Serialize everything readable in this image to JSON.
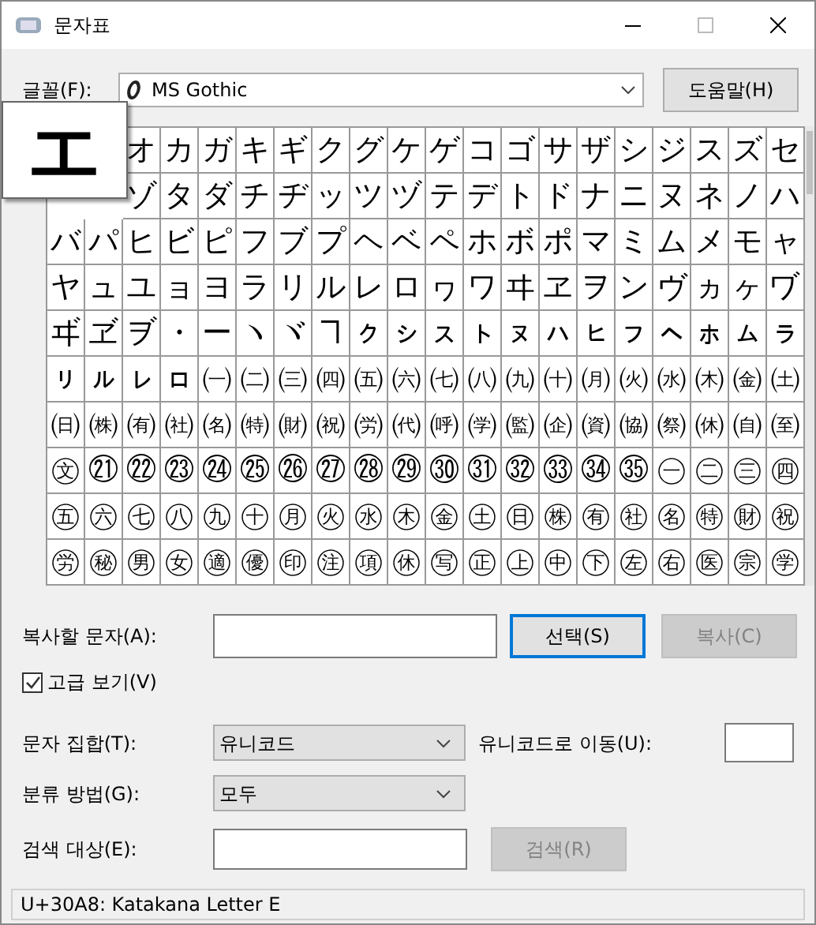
{
  "window": {
    "title": "문자표"
  },
  "font": {
    "label": "글꼴(F):",
    "value": "MS Gothic",
    "help_button": "도움말(H)"
  },
  "magnifier": {
    "char": "エ"
  },
  "grid": [
    [
      "オ",
      "カ",
      "ガ",
      "キ",
      "ギ",
      "ク",
      "グ",
      "ケ",
      "ゲ",
      "コ",
      "ゴ",
      "サ",
      "ザ",
      "シ",
      "ジ",
      "ス",
      "ズ",
      "セ"
    ],
    [
      "ゾ",
      "タ",
      "ダ",
      "チ",
      "ヂ",
      "ッ",
      "ツ",
      "ヅ",
      "テ",
      "デ",
      "ト",
      "ド",
      "ナ",
      "ニ",
      "ヌ",
      "ネ",
      "ノ",
      "ハ"
    ],
    [
      "バ",
      "パ",
      "ヒ",
      "ビ",
      "ピ",
      "フ",
      "ブ",
      "プ",
      "ヘ",
      "ベ",
      "ペ",
      "ホ",
      "ボ",
      "ポ",
      "マ",
      "ミ",
      "ム",
      "メ",
      "モ",
      "ャ"
    ],
    [
      "ヤ",
      "ュ",
      "ユ",
      "ョ",
      "ヨ",
      "ラ",
      "リ",
      "ル",
      "レ",
      "ロ",
      "ヮ",
      "ワ",
      "ヰ",
      "ヱ",
      "ヲ",
      "ン",
      "ヴ",
      "ヵ",
      "ヶ",
      "ヷ"
    ],
    [
      "ヸ",
      "ヹ",
      "ヺ",
      "・",
      "ー",
      "ヽ",
      "ヾ",
      "ヿ",
      "ㇰ",
      "ㇱ",
      "ㇲ",
      "ㇳ",
      "ㇴ",
      "ㇵ",
      "ㇶ",
      "ㇷ",
      "ㇸ",
      "ㇹ",
      "ㇺ",
      "ㇻ"
    ],
    [
      "ㇼ",
      "ㇽ",
      "ㇾ",
      "ㇿ",
      "㈠",
      "㈡",
      "㈢",
      "㈣",
      "㈤",
      "㈥",
      "㈦",
      "㈧",
      "㈨",
      "㈩",
      "㈪",
      "㈫",
      "㈬",
      "㈭",
      "㈮",
      "㈯"
    ],
    [
      "㈰",
      "㈱",
      "㈲",
      "㈳",
      "㈴",
      "㈵",
      "㈶",
      "㈷",
      "㈸",
      "㈹",
      "㈺",
      "㈻",
      "㈼",
      "㈽",
      "㈾",
      "㈿",
      "㉀",
      "㉁",
      "㉂",
      "㉃"
    ],
    [
      "㉆",
      "㉑",
      "㉒",
      "㉓",
      "㉔",
      "㉕",
      "㉖",
      "㉗",
      "㉘",
      "㉙",
      "㉚",
      "㉛",
      "㉜",
      "㉝",
      "㉞",
      "㉟",
      "㊀",
      "㊁",
      "㊂",
      "㊃"
    ],
    [
      "㊄",
      "㊅",
      "㊆",
      "㊇",
      "㊈",
      "㊉",
      "㊊",
      "㊋",
      "㊌",
      "㊍",
      "㊎",
      "㊏",
      "㊐",
      "㊑",
      "㊒",
      "㊓",
      "㊔",
      "㊕",
      "㊖",
      "㊗"
    ],
    [
      "㊘",
      "㊙",
      "㊚",
      "㊛",
      "㊜",
      "㊝",
      "㊞",
      "㊟",
      "㊠",
      "㊡",
      "㊢",
      "㊣",
      "㊤",
      "㊥",
      "㊦",
      "㊧",
      "㊨",
      "㊩",
      "㊪",
      "㊫"
    ]
  ],
  "copy": {
    "label": "복사할 문자(A):",
    "select_button": "선택(S)",
    "copy_button": "복사(C)",
    "copy_disabled": true
  },
  "advanced": {
    "label": "고급 보기(V)",
    "checked": true
  },
  "charset": {
    "label": "문자 집합(T):",
    "value": "유니코드",
    "goto_label": "유니코드로 이동(U):"
  },
  "group_by": {
    "label": "분류 방법(G):",
    "value": "모두"
  },
  "search": {
    "label": "검색 대상(E):",
    "button": "검색(R)",
    "button_disabled": true
  },
  "status_bar": "U+30A8: Katakana Letter E"
}
